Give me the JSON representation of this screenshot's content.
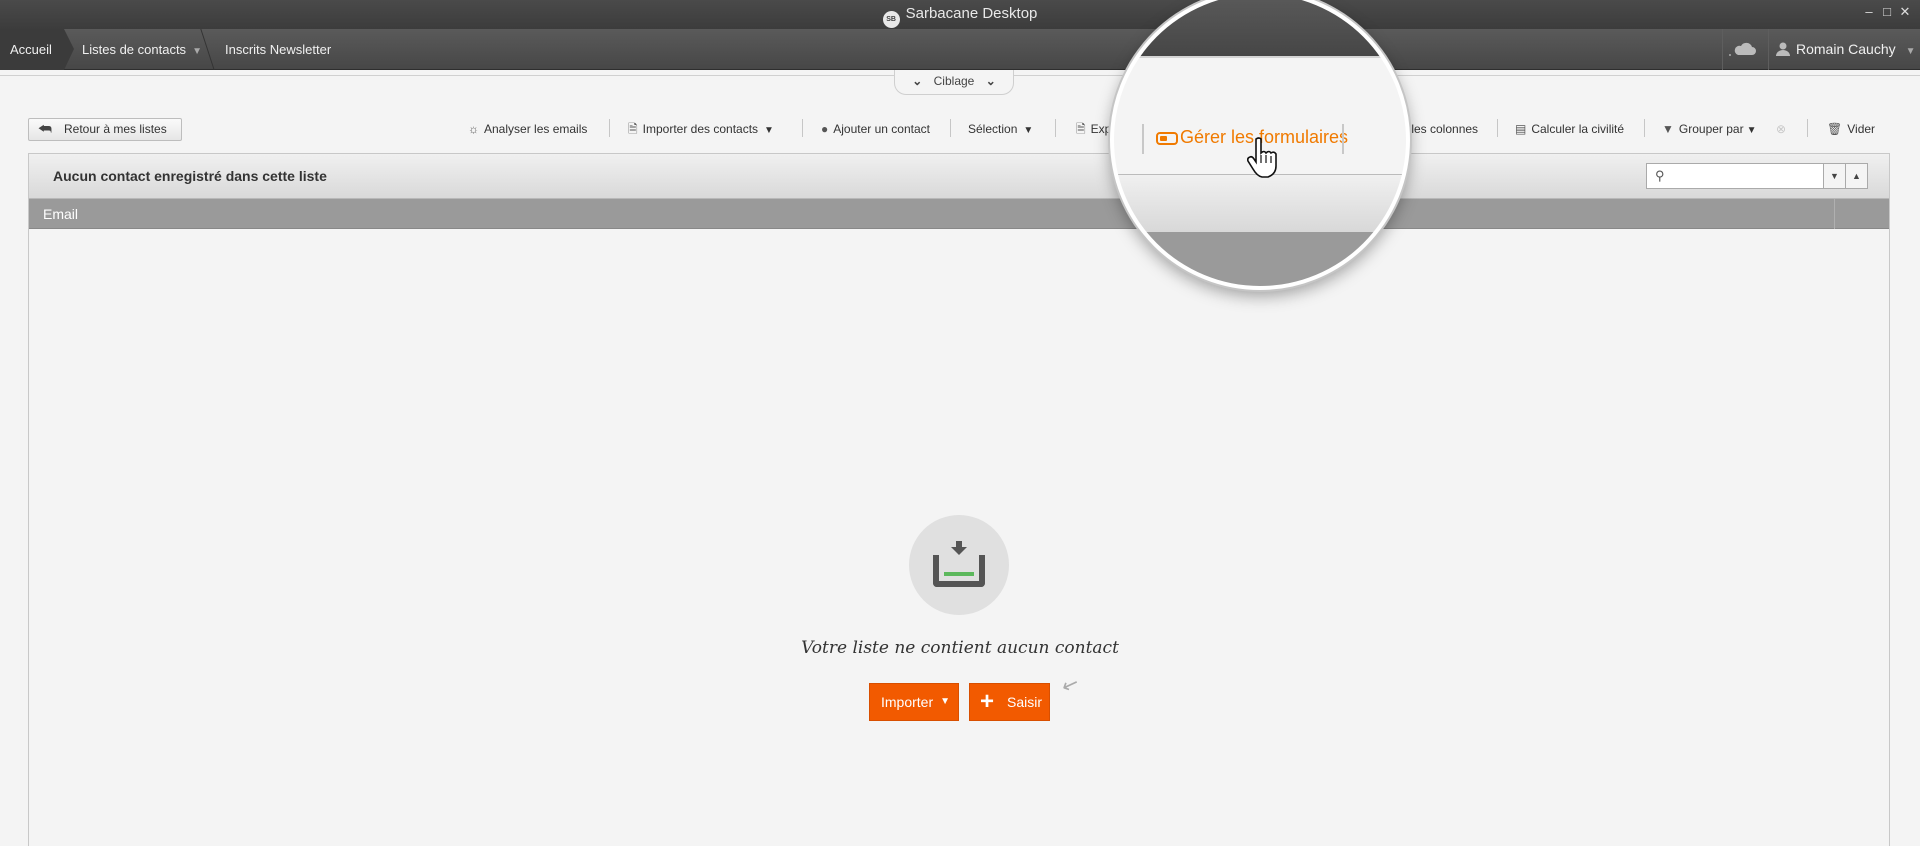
{
  "window": {
    "title": "Sarbacane Desktop",
    "logo_text": "SB"
  },
  "nav": {
    "breadcrumbs": [
      "Accueil",
      "Listes de contacts",
      "Inscrits Newsletter"
    ],
    "user_name": "Romain Cauchy"
  },
  "ciblage": {
    "label": "Ciblage"
  },
  "toolbar": {
    "back_label": "Retour à mes listes",
    "analyse_label": "Analyser les emails",
    "import_label": "Importer des contacts",
    "add_label": "Ajouter un contact",
    "selection_label": "Sélection",
    "export_label": "Expo",
    "columns_label": "r les colonnes",
    "civility_label": "Calculer la civilité",
    "group_label": "Grouper par",
    "clear_label": "Vider"
  },
  "panel": {
    "title": "Aucun contact enregistré dans cette liste",
    "column_header": "Email",
    "search_value": ""
  },
  "empty_state": {
    "message": "Votre liste ne contient aucun contact",
    "import_button": "Importer",
    "saisir_button": "Saisir"
  },
  "magnifier": {
    "label": "Gérer les formulaires"
  },
  "colors": {
    "accent": "#f25a00",
    "magnifier_label": "#f07a00",
    "titlebar": "#3c3c3c"
  }
}
